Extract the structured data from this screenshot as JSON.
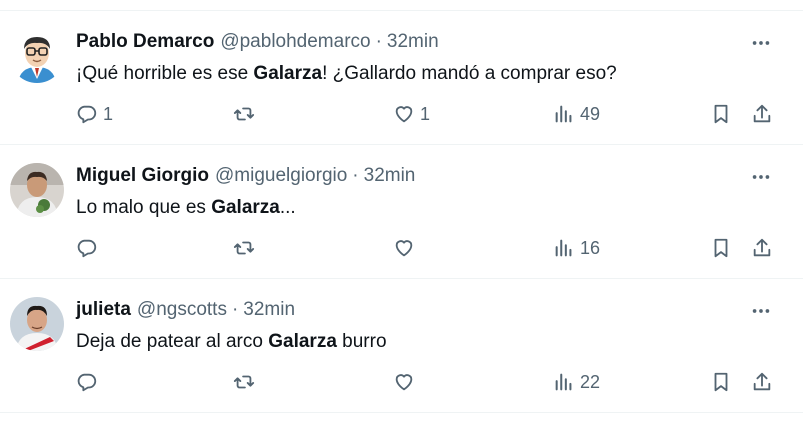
{
  "tweets": [
    {
      "name": "Pablo Demarco",
      "handle": "@pablohdemarco",
      "separator": "·",
      "time": "32min",
      "text_parts": [
        "¡Qué horrible es ese ",
        "Galarza",
        "! ¿Gallardo mandó a comprar eso?"
      ],
      "replies": "1",
      "retweets": "",
      "likes": "1",
      "views": "49",
      "avatar": "cartoon-avatar"
    },
    {
      "name": "Miguel Giorgio",
      "handle": "@miguelgiorgio",
      "separator": "·",
      "time": "32min",
      "text_parts": [
        "Lo malo que es ",
        "Galarza",
        "..."
      ],
      "replies": "",
      "retweets": "",
      "likes": "",
      "views": "16",
      "avatar": "photo-avatar"
    },
    {
      "name": "julieta",
      "handle": "@ngscotts",
      "separator": "·",
      "time": "32min",
      "text_parts": [
        "Deja de patear al arco ",
        "Galarza",
        " burro"
      ],
      "replies": "",
      "retweets": "",
      "likes": "",
      "views": "22",
      "avatar": "player-photo-avatar"
    }
  ],
  "icons": {
    "reply": "reply-icon",
    "retweet": "retweet-icon",
    "like": "heart-icon",
    "views": "views-icon",
    "bookmark": "bookmark-icon",
    "share": "share-icon",
    "more": "more-icon"
  },
  "colors": {
    "text": "#0f1419",
    "secondary": "#536471",
    "divider": "#eff3f4"
  }
}
